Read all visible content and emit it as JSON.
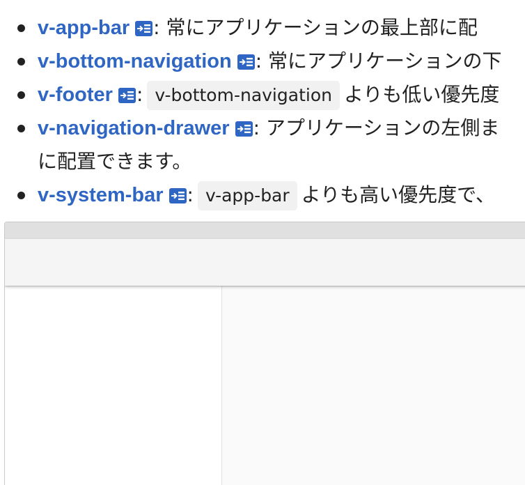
{
  "components": [
    {
      "link": "v-app-bar",
      "icon": "api-page-icon",
      "separator": ":",
      "code": "",
      "description": " 常にアプリケーションの最上部に配"
    },
    {
      "link": "v-bottom-navigation",
      "icon": "api-page-icon",
      "separator": ":",
      "code": "",
      "description": " 常にアプリケーションの下"
    },
    {
      "link": "v-footer",
      "icon": "api-page-icon",
      "separator": ":",
      "code": "v-bottom-navigation",
      "description": "よりも低い優先度"
    },
    {
      "link": "v-navigation-drawer",
      "icon": "api-page-icon",
      "separator": ":",
      "code": "",
      "description": " アプリケーションの左側ま",
      "continuation": "に配置できます。"
    },
    {
      "link": "v-system-bar",
      "icon": "api-page-icon",
      "separator": ":",
      "code": "v-app-bar",
      "description": "よりも高い優先度で、"
    }
  ],
  "colors": {
    "link": "#2f66c4",
    "icon": "#2f66c4",
    "code_background": "#f1f1f1",
    "system_bar": "#e0e0e0",
    "app_bar": "#f5f5f5",
    "drawer": "#ffffff",
    "main": "#fafafa"
  }
}
